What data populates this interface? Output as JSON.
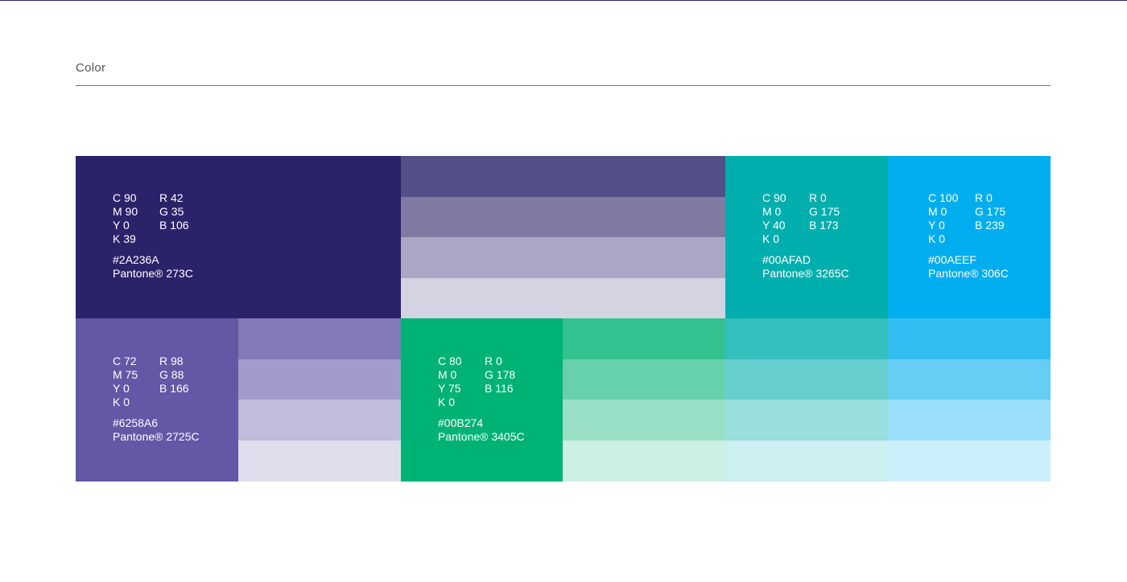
{
  "section": {
    "title": "Color"
  },
  "colors": {
    "indigo": {
      "hex_value": "#2A236A",
      "tints": [
        "#554F87",
        "#7F7AA2",
        "#AAA7C4",
        "#D4D3E1"
      ],
      "c": "C 90",
      "r": "R 42",
      "m": "M 90",
      "g": "G 35",
      "y": "Y 0",
      "b": "B 106",
      "k": "K 39",
      "hex": "#2A236A",
      "pantone": "Pantone® 273C"
    },
    "teal": {
      "hex_value": "#00AFAD",
      "tints": [
        "#33BFBD",
        "#66CFCE",
        "#99DFDE",
        "#CCEFEF"
      ],
      "c": "C 90",
      "r": "R 0",
      "m": "M 0",
      "g": "G 175",
      "y": "Y 40",
      "b": "B 173",
      "k": "K 0",
      "hex": "#00AFAD",
      "pantone": "Pantone® 3265C"
    },
    "sky": {
      "hex_value": "#00AEEF",
      "tints": [
        "#33BEF2",
        "#66CEF5",
        "#99DFF9",
        "#CCEFFC"
      ],
      "c": "C 100",
      "r": "R 0",
      "m": "M 0",
      "g": "G 175",
      "y": "Y 0",
      "b": "B 239",
      "k": "K 0",
      "hex": "#00AEEF",
      "pantone": "Pantone® 306C"
    },
    "violet": {
      "hex_value": "#6258A6",
      "tints": [
        "#8179B8",
        "#A09BCA",
        "#C0BCDB",
        "#DFDEED"
      ],
      "c": "C 72",
      "r": "R 98",
      "m": "M 75",
      "g": "G 88",
      "y": "Y 0",
      "b": "B 166",
      "k": "K 0",
      "hex": "#6258A6",
      "pantone": "Pantone® 2725C"
    },
    "green": {
      "hex_value": "#00B274",
      "tints": [
        "#33C190",
        "#66D1AC",
        "#99E0C7",
        "#CCF0E3"
      ],
      "c": "C 80",
      "r": "R 0",
      "m": "M 0",
      "g": "G 178",
      "y": "Y 75",
      "b": "B 116",
      "k": "K 0",
      "hex": "#00B274",
      "pantone": "Pantone® 3405C"
    }
  }
}
